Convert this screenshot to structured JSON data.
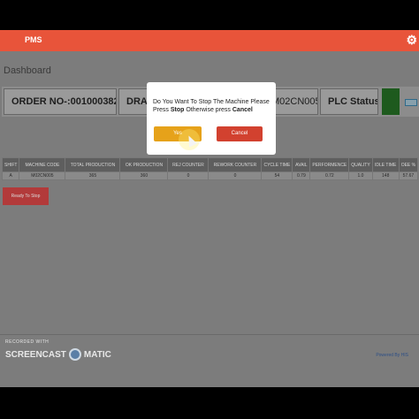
{
  "header": {
    "title": "PMS",
    "settings_icon": "gear-icon"
  },
  "page": {
    "title": "Dashboard"
  },
  "infobar": {
    "order": "ORDER NO-:001000382626",
    "drawing": "DRAW",
    "machine": "M02CN005",
    "plc_status": "PLC Status :",
    "plc_status_color": "#1e5a1e"
  },
  "table": {
    "columns": [
      "SHIFT",
      "MACHINE CODE",
      "TOTAL PRODUCTION",
      "OK PRODUCTION",
      "REJ COUNTER",
      "REWORK COUNTER",
      "CYCLE TIME",
      "AVAIL",
      "PERFORMENCE",
      "QUALITY",
      "IDLE TIME",
      "OEE %"
    ],
    "rows": [
      [
        "A",
        "M02CN005",
        "365",
        "360",
        "0",
        "0",
        "54",
        "0.79",
        "0.72",
        "1.0",
        "148",
        "57.67"
      ]
    ]
  },
  "ready_button": "Ready To Stop",
  "dialog": {
    "message_pre": "Do You Want To Stop The Machine Please Press ",
    "message_stop": "Stop",
    "message_mid": " Otherwise press ",
    "message_cancel": "Cancel",
    "yes_label": "Yes",
    "cancel_label": "Cancel"
  },
  "footer": {
    "powered_by": "Powered By HIS"
  },
  "watermark": {
    "recorded": "RECORDED WITH",
    "brand_left": "SCREENCAST",
    "brand_right": "MATIC"
  },
  "colors": {
    "header": "#e8543a",
    "yes": "#e6a21a",
    "cancel": "#d2412f"
  }
}
